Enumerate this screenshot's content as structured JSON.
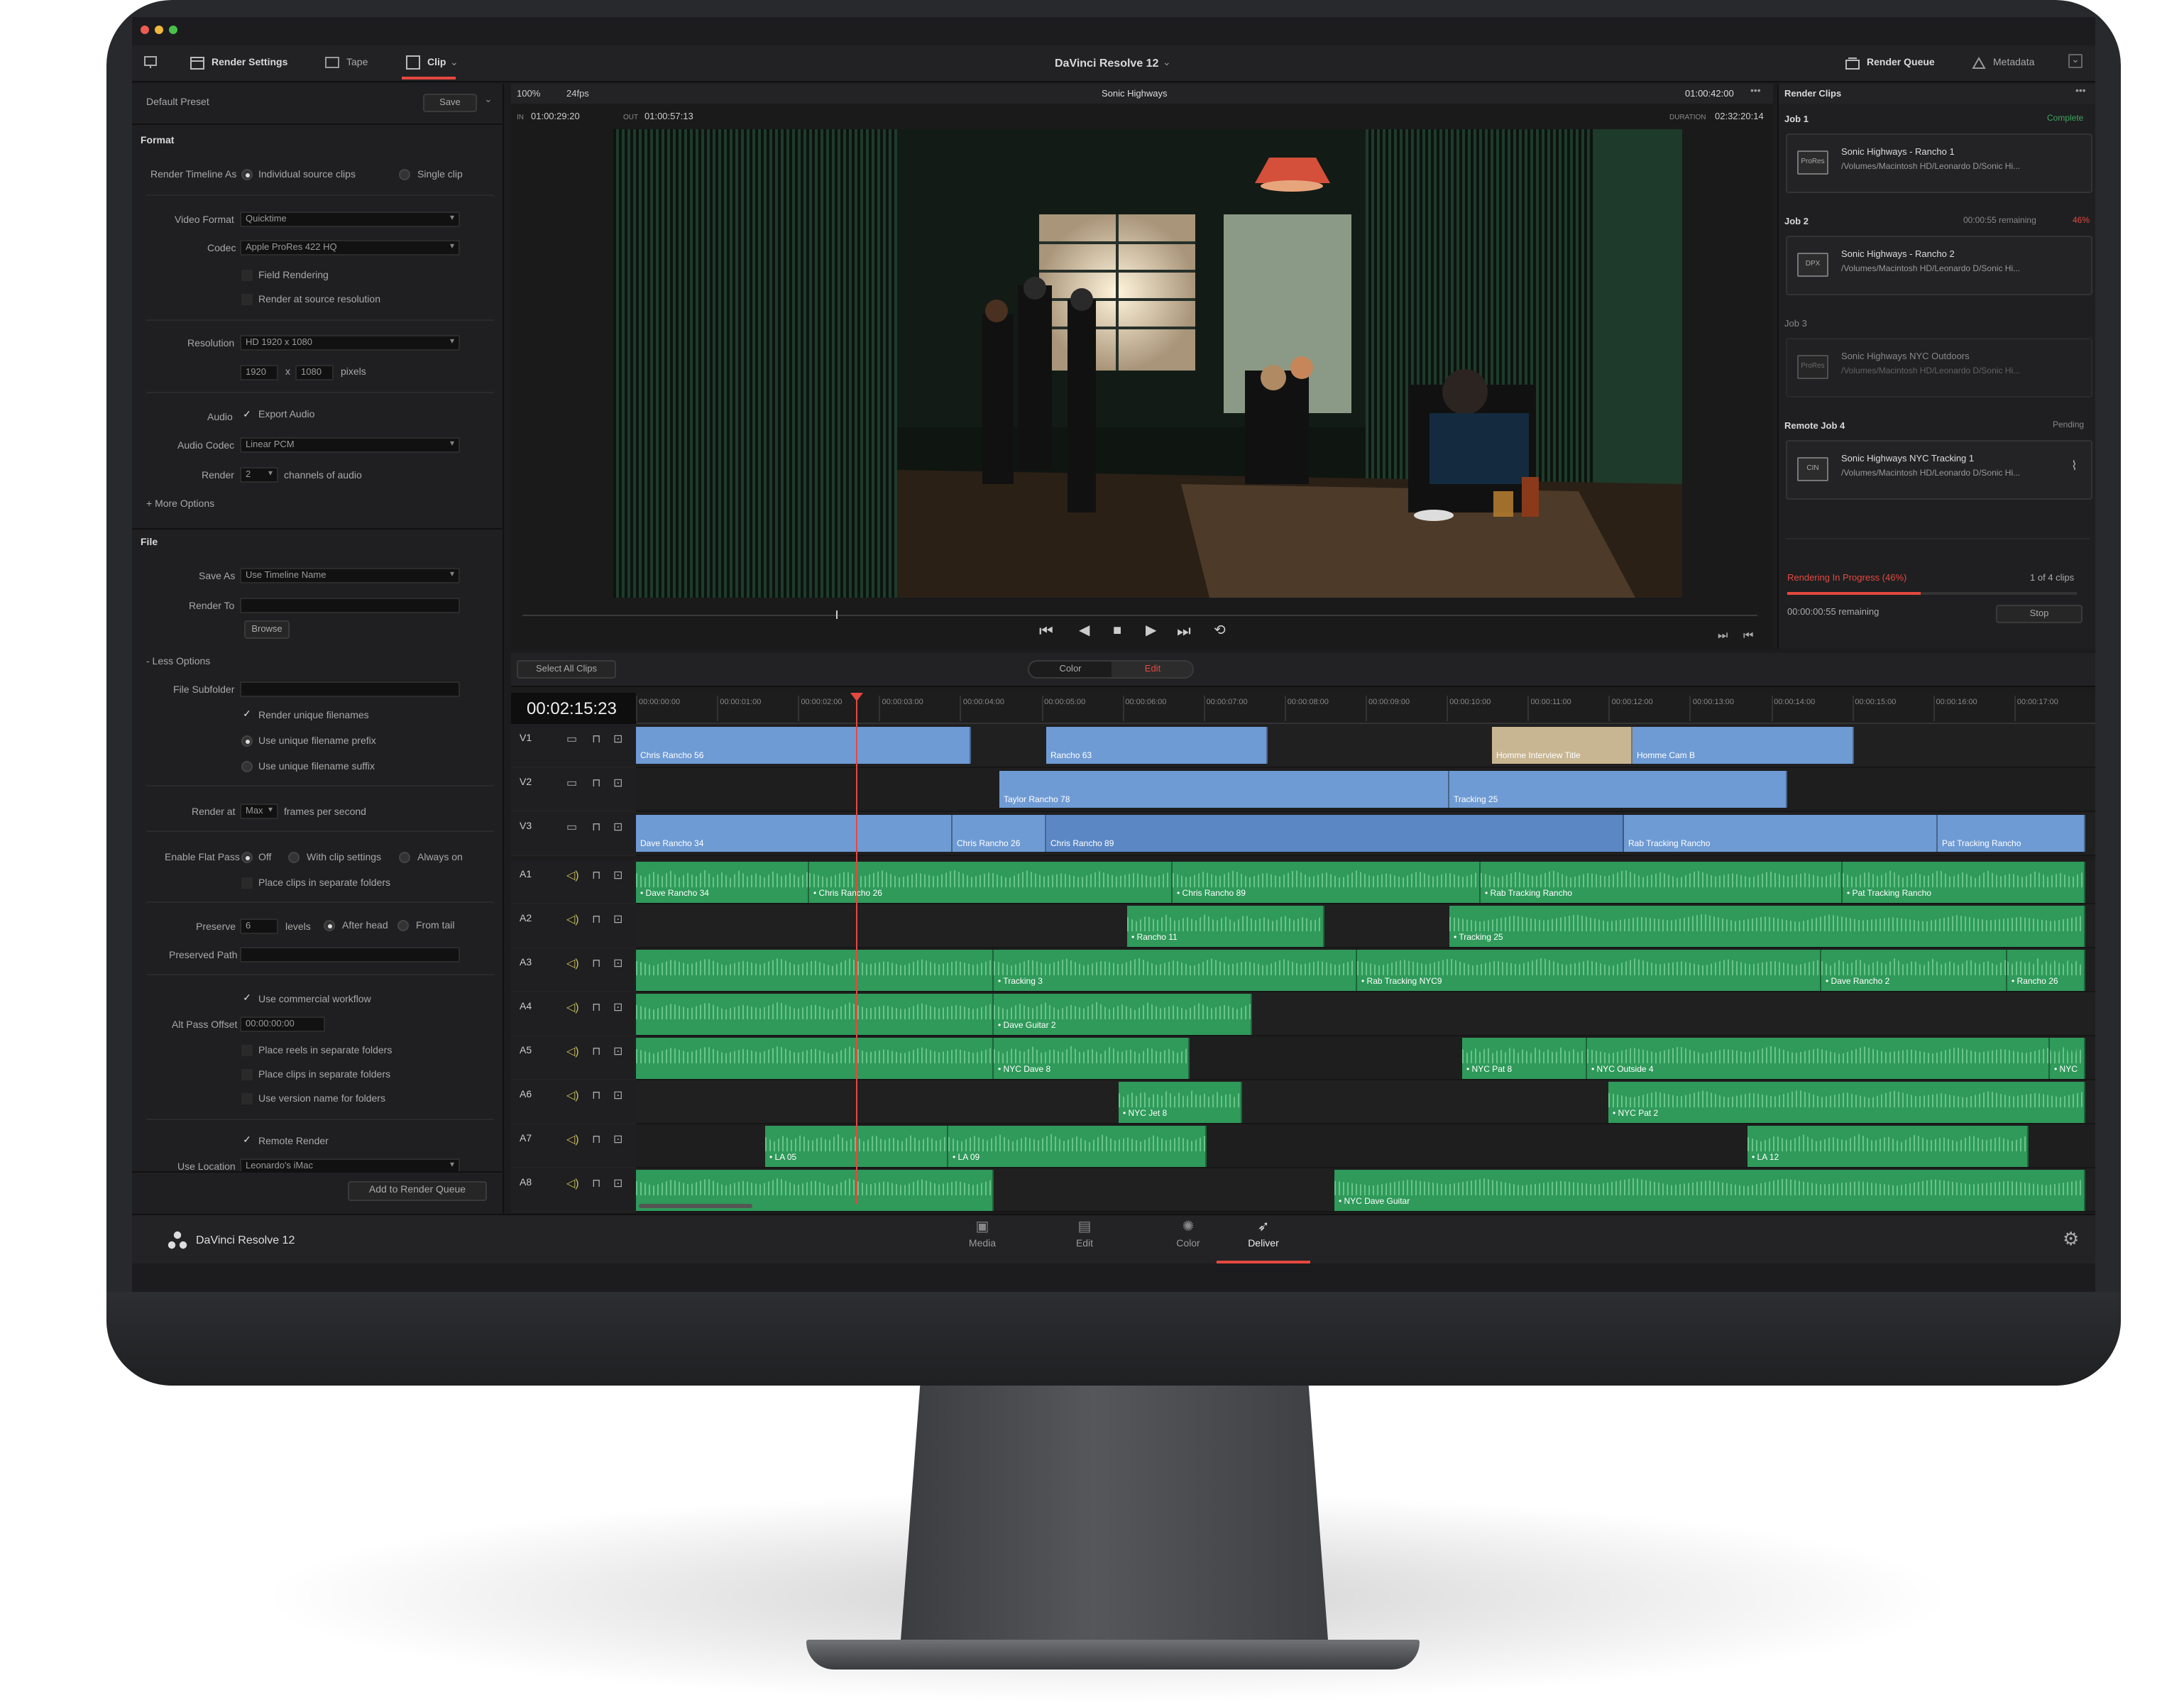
{
  "app": {
    "title": "DaVinci Resolve 12",
    "brand": "DaVinci Resolve 12"
  },
  "toolbar": {
    "render_settings": "Render Settings",
    "tape": "Tape",
    "clip": "Clip",
    "render_queue": "Render Queue",
    "metadata": "Metadata"
  },
  "left": {
    "preset": "Default Preset",
    "save": "Save",
    "format_heading": "Format",
    "render_timeline_as": "Render Timeline As",
    "individual_clips": "Individual source clips",
    "single_clip": "Single clip",
    "video_format_label": "Video Format",
    "video_format": "Quicktime",
    "codec_label": "Codec",
    "codec": "Apple ProRes 422 HQ",
    "field_rendering": "Field Rendering",
    "render_source_res": "Render at source resolution",
    "resolution_label": "Resolution",
    "resolution": "HD 1920 x 1080",
    "width": "1920",
    "times": "x",
    "height": "1080",
    "pixels": "pixels",
    "audio_label": "Audio",
    "export_audio": "Export Audio",
    "audio_codec_label": "Audio Codec",
    "audio_codec": "Linear PCM",
    "render_label": "Render",
    "channels": "2",
    "channels_of_audio": "channels of audio",
    "more_options": "+ More Options",
    "file_heading": "File",
    "save_as_label": "Save As",
    "save_as": "Use Timeline Name",
    "render_to_label": "Render To",
    "browse": "Browse",
    "less_options": "- Less Options",
    "file_subfolder": "File Subfolder",
    "unique_filenames": "Render unique filenames",
    "unique_prefix": "Use unique filename prefix",
    "unique_suffix": "Use unique filename suffix",
    "render_at_label": "Render at",
    "render_at": "Max",
    "fps": "frames per second",
    "flat_pass_label": "Enable Flat Pass",
    "off": "Off",
    "with_clip": "With clip settings",
    "always_on": "Always on",
    "separate_folders": "Place clips in separate folders",
    "preserve_label": "Preserve",
    "preserve_levels": "6",
    "levels": "levels",
    "after_head": "After head",
    "from_tail": "From tail",
    "preserved_path": "Preserved Path",
    "commercial_workflow": "Use commercial workflow",
    "alt_pass_label": "Alt Pass Offset",
    "alt_pass": "00:00:00:00",
    "reels_folders": "Place reels in separate folders",
    "clips_folders": "Place clips in separate folders",
    "version_folders": "Use version name for folders",
    "remote_render": "Remote Render",
    "use_location_label": "Use Location",
    "use_location": "Leonardo's iMac",
    "add_queue": "Add to Render Queue"
  },
  "viewer": {
    "zoom": "100%",
    "fps": "24fps",
    "title": "Sonic Highways",
    "timecode": "01:00:42:00",
    "in_label": "IN",
    "in": "01:00:29:20",
    "out_label": "OUT",
    "out": "01:00:57:13",
    "duration_label": "DURATION",
    "duration": "02:32:20:14"
  },
  "timeline": {
    "select_all": "Select All Clips",
    "color_tab": "Color",
    "edit_tab": "Edit",
    "timecode": "00:02:15:23",
    "ruler": [
      "00:00:00:00",
      "00:00:01:00",
      "00:00:02:00",
      "00:00:03:00",
      "00:00:04:00",
      "00:00:05:00",
      "00:00:06:00",
      "00:00:07:00",
      "00:00:08:00",
      "00:00:09:00",
      "00:00:10:00",
      "00:00:11:00",
      "00:00:12:00",
      "00:00:13:00",
      "00:00:14:00",
      "00:00:15:00",
      "00:00:16:00",
      "00:00:17:00"
    ],
    "tracks": [
      "V1",
      "V2",
      "V3",
      "A1",
      "A2",
      "A3",
      "A4",
      "A5",
      "A6",
      "A7",
      "A8"
    ],
    "video_clips": [
      {
        "track": 0,
        "start": 0,
        "end": 236,
        "label": "Chris Rancho 56"
      },
      {
        "track": 0,
        "start": 289,
        "end": 445,
        "label": "Rancho 63"
      },
      {
        "track": 0,
        "start": 603,
        "end": 702,
        "label": "Homme Interview Title",
        "color": "#c8b692"
      },
      {
        "track": 0,
        "start": 702,
        "end": 858,
        "label": "Homme Cam B"
      },
      {
        "track": 1,
        "start": 256,
        "end": 573,
        "label": "Taylor Rancho 78"
      },
      {
        "track": 1,
        "start": 573,
        "end": 811,
        "label": "Tracking 25"
      },
      {
        "track": 2,
        "start": 0,
        "end": 223,
        "label": "Dave Rancho 34"
      },
      {
        "track": 2,
        "start": 223,
        "end": 289,
        "label": "Chris Rancho 26"
      },
      {
        "track": 2,
        "start": 289,
        "end": 696,
        "label": "Chris Rancho 89",
        "color": "#5b87c4"
      },
      {
        "track": 2,
        "start": 696,
        "end": 917,
        "label": "Rab Tracking Rancho"
      },
      {
        "track": 2,
        "start": 917,
        "end": 1021,
        "label": "Pat Tracking Rancho"
      }
    ],
    "audio_clips": [
      {
        "track": 0,
        "start": 0,
        "end": 122,
        "label": "Dave Rancho 34"
      },
      {
        "track": 0,
        "start": 122,
        "end": 378,
        "label": "Chris Rancho 26"
      },
      {
        "track": 0,
        "start": 378,
        "end": 595,
        "label": "Chris Rancho 89"
      },
      {
        "track": 0,
        "start": 595,
        "end": 850,
        "label": "Rab Tracking Rancho"
      },
      {
        "track": 0,
        "start": 850,
        "end": 1021,
        "label": "Pat Tracking Rancho"
      },
      {
        "track": 1,
        "start": 346,
        "end": 485,
        "label": "Rancho 11"
      },
      {
        "track": 1,
        "start": 573,
        "end": 1021,
        "label": "Tracking 25"
      },
      {
        "track": 2,
        "start": 0,
        "end": 252,
        "label": ""
      },
      {
        "track": 2,
        "start": 252,
        "end": 508,
        "label": "Tracking 3"
      },
      {
        "track": 2,
        "start": 508,
        "end": 835,
        "label": "Rab Tracking NYC9"
      },
      {
        "track": 2,
        "start": 835,
        "end": 966,
        "label": "Dave Rancho 2"
      },
      {
        "track": 2,
        "start": 966,
        "end": 1021,
        "label": "Rancho 26"
      },
      {
        "track": 3,
        "start": 0,
        "end": 252,
        "label": ""
      },
      {
        "track": 3,
        "start": 252,
        "end": 434,
        "label": "Dave Guitar 2"
      },
      {
        "track": 4,
        "start": 0,
        "end": 252,
        "label": ""
      },
      {
        "track": 4,
        "start": 252,
        "end": 390,
        "label": "NYC Dave 8"
      },
      {
        "track": 4,
        "start": 582,
        "end": 670,
        "label": "NYC Pat 8"
      },
      {
        "track": 4,
        "start": 670,
        "end": 996,
        "label": "NYC Outside 4"
      },
      {
        "track": 4,
        "start": 996,
        "end": 1021,
        "label": "NYC"
      },
      {
        "track": 5,
        "start": 340,
        "end": 427,
        "label": "NYC Jet 8"
      },
      {
        "track": 5,
        "start": 685,
        "end": 1021,
        "label": "NYC Pat 2"
      },
      {
        "track": 6,
        "start": 91,
        "end": 220,
        "label": "LA 05"
      },
      {
        "track": 6,
        "start": 220,
        "end": 402,
        "label": "LA 09"
      },
      {
        "track": 6,
        "start": 783,
        "end": 981,
        "label": "LA 12"
      },
      {
        "track": 7,
        "start": 0,
        "end": 252,
        "label": ""
      },
      {
        "track": 7,
        "start": 492,
        "end": 1021,
        "label": "NYC Dave Guitar"
      }
    ]
  },
  "queue": {
    "title": "Render Clips",
    "jobs": [
      {
        "name": "Job 1",
        "status": "Complete",
        "clip": "Sonic Highways - Rancho 1",
        "path": "/Volumes/Macintosh HD/Leonardo D/Sonic Hi...",
        "icon": "ProRes"
      },
      {
        "name": "Job 2",
        "status": "00:00:55 remaining",
        "pct": "46%",
        "clip": "Sonic Highways - Rancho 2",
        "path": "/Volumes/Macintosh HD/Leonardo D/Sonic Hi...",
        "icon": "DPX"
      },
      {
        "name": "Job 3",
        "status": "",
        "clip": "Sonic Highways NYC Outdoors",
        "path": "/Volumes/Macintosh HD/Leonardo D/Sonic Hi...",
        "icon": "ProRes"
      },
      {
        "name": "Remote Job 4",
        "status": "Pending",
        "clip": "Sonic Highways NYC Tracking 1",
        "path": "/Volumes/Macintosh HD/Leonardo D/Sonic Hi...",
        "icon": "CIN"
      }
    ],
    "progress_label": "Rendering In Progress (46%)",
    "progress_count": "1 of 4 clips",
    "progress": 0.46,
    "remaining": "00:00:00:55 remaining",
    "stop": "Stop"
  },
  "pages": [
    {
      "label": "Media",
      "icon": "media-icon"
    },
    {
      "label": "Edit",
      "icon": "edit-icon"
    },
    {
      "label": "Color",
      "icon": "color-icon"
    },
    {
      "label": "Deliver",
      "icon": "deliver-icon",
      "active": true
    }
  ],
  "colors": {
    "accent": "#e5483f",
    "complete": "#3ca55c",
    "video": "#6f9bd4",
    "audio": "#2f9a5a"
  }
}
